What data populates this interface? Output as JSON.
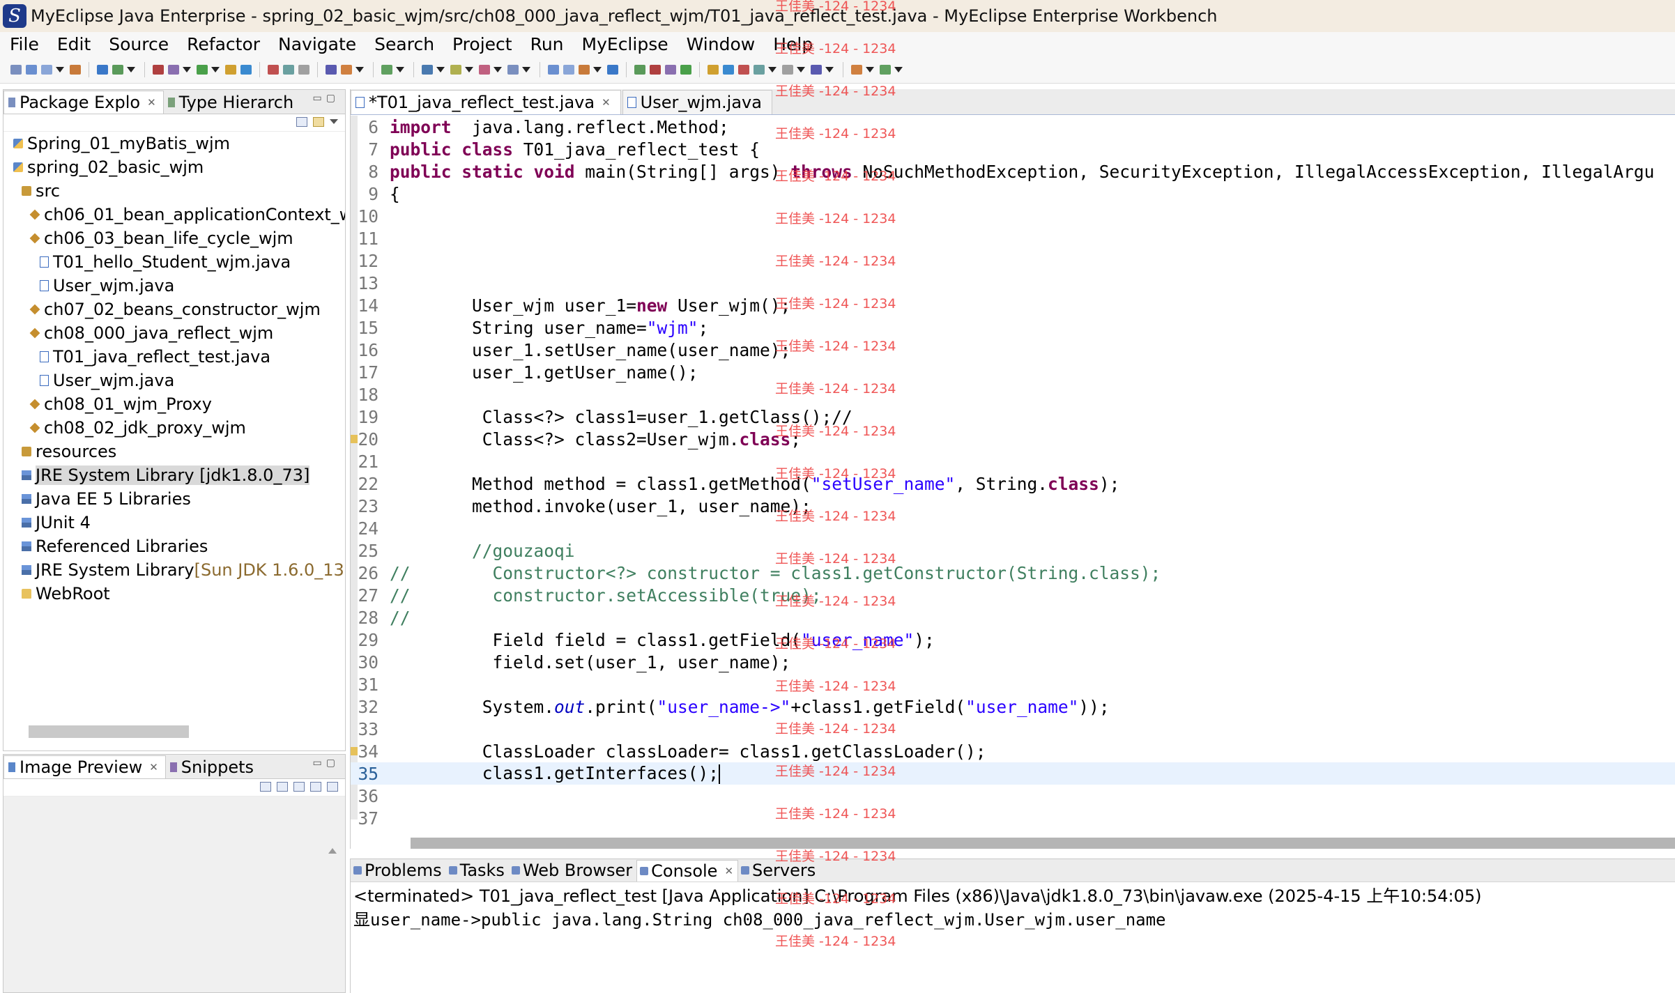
{
  "window": {
    "title": "MyEclipse Java Enterprise - spring_02_basic_wjm/src/ch08_000_java_reflect_wjm/T01_java_reflect_test.java - MyEclipse Enterprise Workbench"
  },
  "menu": [
    "File",
    "Edit",
    "Source",
    "Refactor",
    "Navigate",
    "Search",
    "Project",
    "Run",
    "MyEclipse",
    "Window",
    "Help"
  ],
  "left_panel": {
    "tabs": [
      {
        "label": "Package Explo",
        "active": true
      },
      {
        "label": "Type Hierarch",
        "active": false
      }
    ],
    "tree": [
      {
        "label": "Spring_01_myBatis_wjm",
        "indent": 1,
        "icon": "project-icon"
      },
      {
        "label": "spring_02_basic_wjm",
        "indent": 1,
        "icon": "project-icon"
      },
      {
        "label": "src",
        "indent": 2,
        "icon": "source-folder-icon"
      },
      {
        "label": "ch06_01_bean_applicationContext_w",
        "indent": 3,
        "icon": "package-icon"
      },
      {
        "label": "ch06_03_bean_life_cycle_wjm",
        "indent": 3,
        "icon": "package-icon"
      },
      {
        "label": "T01_hello_Student_wjm.java",
        "indent": 4,
        "icon": "java-file-icon"
      },
      {
        "label": "User_wjm.java",
        "indent": 4,
        "icon": "java-file-icon"
      },
      {
        "label": "ch07_02_beans_constructor_wjm",
        "indent": 3,
        "icon": "package-icon"
      },
      {
        "label": "ch08_000_java_reflect_wjm",
        "indent": 3,
        "icon": "package-icon"
      },
      {
        "label": "T01_java_reflect_test.java",
        "indent": 4,
        "icon": "java-file-icon"
      },
      {
        "label": "User_wjm.java",
        "indent": 4,
        "icon": "java-file-icon"
      },
      {
        "label": "ch08_01_wjm_Proxy",
        "indent": 3,
        "icon": "package-icon"
      },
      {
        "label": "ch08_02_jdk_proxy_wjm",
        "indent": 3,
        "icon": "package-icon"
      },
      {
        "label": "resources",
        "indent": 2,
        "icon": "source-folder-icon"
      },
      {
        "label": "JRE System Library [jdk1.8.0_73]",
        "indent": 2,
        "icon": "library-icon",
        "selected": true
      },
      {
        "label": "Java EE 5 Libraries",
        "indent": 2,
        "icon": "library-icon"
      },
      {
        "label": "JUnit 4",
        "indent": 2,
        "icon": "library-icon"
      },
      {
        "label": "Referenced Libraries",
        "indent": 2,
        "icon": "library-icon"
      },
      {
        "label": "JRE System Library",
        "decoration": " [Sun JDK 1.6.0_13]",
        "indent": 2,
        "icon": "library-icon"
      },
      {
        "label": "WebRoot",
        "indent": 2,
        "icon": "folder-icon"
      }
    ]
  },
  "preview_panel": {
    "tabs": [
      {
        "label": "Image Preview",
        "active": true
      },
      {
        "label": "Snippets",
        "active": false
      }
    ]
  },
  "editor": {
    "tabs": [
      {
        "label": "*T01_java_reflect_test.java",
        "active": true
      },
      {
        "label": "User_wjm.java",
        "active": false
      }
    ],
    "current_line": 35,
    "lines": [
      {
        "n": "6",
        "spans": [
          [
            "kw",
            "import"
          ],
          [
            "",
            "  java.lang.reflect.Method;"
          ]
        ]
      },
      {
        "n": "7",
        "spans": [
          [
            "kw",
            "public class"
          ],
          [
            "",
            " T01_java_reflect_test {"
          ]
        ]
      },
      {
        "n": "8",
        "spans": [
          [
            "kw",
            "public static void"
          ],
          [
            "",
            " main(String[] args) "
          ],
          [
            "kw",
            "throws"
          ],
          [
            "",
            " NoSuchMethodException, SecurityException, IllegalAccessException, IllegalArgu"
          ]
        ]
      },
      {
        "n": "9",
        "spans": [
          [
            "",
            "{"
          ]
        ]
      },
      {
        "n": "10",
        "spans": []
      },
      {
        "n": "11",
        "spans": []
      },
      {
        "n": "12",
        "spans": []
      },
      {
        "n": "13",
        "spans": []
      },
      {
        "n": "14",
        "spans": [
          [
            "",
            "        User_wjm user_1="
          ],
          [
            "kw",
            "new"
          ],
          [
            "",
            " User_wjm();"
          ]
        ]
      },
      {
        "n": "15",
        "spans": [
          [
            "",
            "        String user_name="
          ],
          [
            "str",
            "\"wjm\""
          ],
          [
            "",
            ";"
          ]
        ]
      },
      {
        "n": "16",
        "spans": [
          [
            "",
            "        user_1.setUser_name(user_name);"
          ]
        ]
      },
      {
        "n": "17",
        "spans": [
          [
            "",
            "        user_1.getUser_name();"
          ]
        ]
      },
      {
        "n": "18",
        "spans": []
      },
      {
        "n": "19",
        "spans": [
          [
            "",
            "         Class<?> class1=user_1.getClass();//"
          ]
        ]
      },
      {
        "n": "20",
        "spans": [
          [
            "",
            "         Class<?> class2=User_wjm."
          ],
          [
            "kw",
            "class"
          ],
          [
            "",
            ";"
          ]
        ]
      },
      {
        "n": "21",
        "spans": []
      },
      {
        "n": "22",
        "spans": [
          [
            "",
            "        Method method = class1.getMethod("
          ],
          [
            "str",
            "\"setUser_name\""
          ],
          [
            "",
            ", String."
          ],
          [
            "kw",
            "class"
          ],
          [
            "",
            ");"
          ]
        ]
      },
      {
        "n": "23",
        "spans": [
          [
            "",
            "        method.invoke(user_1, user_name);"
          ]
        ]
      },
      {
        "n": "24",
        "spans": []
      },
      {
        "n": "25",
        "spans": [
          [
            "cm",
            "        //gouzaoqi"
          ]
        ]
      },
      {
        "n": "26",
        "spans": [
          [
            "cm",
            "//        Constructor<?> constructor = class1.getConstructor(String.class);"
          ]
        ]
      },
      {
        "n": "27",
        "spans": [
          [
            "cm",
            "//        constructor.setAccessible(true);"
          ]
        ]
      },
      {
        "n": "28",
        "spans": [
          [
            "cm",
            "//"
          ]
        ]
      },
      {
        "n": "29",
        "spans": [
          [
            "",
            "          Field field = class1.getField("
          ],
          [
            "str",
            "\"user_name\""
          ],
          [
            "",
            ");"
          ]
        ]
      },
      {
        "n": "30",
        "spans": [
          [
            "",
            "          field.set(user_1, user_name);"
          ]
        ]
      },
      {
        "n": "31",
        "spans": []
      },
      {
        "n": "32",
        "spans": [
          [
            "",
            "         System."
          ],
          [
            "fld",
            "out"
          ],
          [
            "",
            ".print("
          ],
          [
            "str",
            "\"user_name->\""
          ],
          [
            "",
            "+class1.getField("
          ],
          [
            "str",
            "\"user_name\""
          ],
          [
            "",
            "));"
          ]
        ]
      },
      {
        "n": "33",
        "spans": []
      },
      {
        "n": "34",
        "spans": [
          [
            "",
            "         ClassLoader classLoader= class1.getClassLoader();"
          ]
        ]
      },
      {
        "n": "35",
        "spans": [
          [
            "",
            "         class1.getInterfaces();"
          ]
        ]
      },
      {
        "n": "36",
        "spans": []
      },
      {
        "n": "37",
        "spans": []
      }
    ]
  },
  "bottom_panel": {
    "tabs": [
      {
        "label": "Problems",
        "active": false
      },
      {
        "label": "Tasks",
        "active": false
      },
      {
        "label": "Web Browser",
        "active": false
      },
      {
        "label": "Console",
        "active": true
      },
      {
        "label": "Servers",
        "active": false
      }
    ],
    "status": "<terminated> T01_java_reflect_test [Java Application] C:\\Program Files (x86)\\Java\\jdk1.8.0_73\\bin\\javaw.exe (2025-4-15 上午10:54:05)",
    "output": "显user_name->public java.lang.String ch08_000_java_reflect_wjm.User_wjm.user_name"
  },
  "watermark": {
    "text": "王佳美 -124 - 1234",
    "color": "#ee4444"
  },
  "colors": {
    "keyword": "#7f0055",
    "string": "#2a00ff",
    "comment": "#3f7f5f",
    "current_line": "#e8f2fe",
    "title_bar": "#f3ece1"
  }
}
